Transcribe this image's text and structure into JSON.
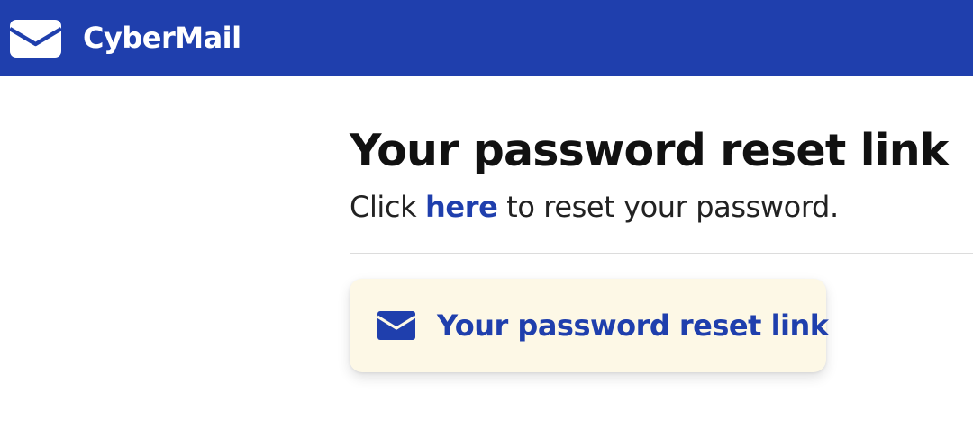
{
  "app": {
    "name": "CyberMail",
    "logo_icon": "envelope-icon"
  },
  "colors": {
    "header_bg": "#1f3fad",
    "accent": "#1f3fad",
    "card_bg": "#fdf8e6"
  },
  "email": {
    "subject": "Your password reset link",
    "body_prefix": "Click ",
    "link_text": "here",
    "body_suffix": " to reset your password."
  },
  "mail_card": {
    "icon": "envelope-icon",
    "label": "Your password reset link"
  }
}
